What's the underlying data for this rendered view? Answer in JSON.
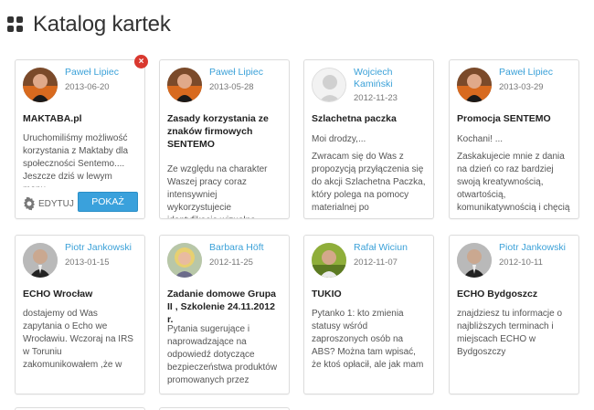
{
  "page": {
    "title": "Katalog kartek"
  },
  "actions": {
    "edit_label": "EDYTUJ",
    "show_label": "POKAŻ",
    "delete_glyph": "×"
  },
  "cards": [
    {
      "author": "Paweł Lipiec",
      "date": "2013-06-20",
      "title": "MAKTABA.pl",
      "text": "Uruchomiliśmy możliwość korzystania z Maktaby dla społeczności Sentemo.... Jeszcze dziś w lewym menu",
      "avatar": "pawel"
    },
    {
      "author": "Paweł Lipiec",
      "date": "2013-05-28",
      "title": "Zasady korzystania ze znaków firmowych SENTEMO",
      "text": "Ze względu na charakter Waszej pracy coraz intensywniej wykorzystujecie identyfikację wizualną marki. Tymczasem korzystanie",
      "avatar": "pawel"
    },
    {
      "author": "Wojciech Kamiński",
      "date": "2012-11-23",
      "title": "Szlachetna paczka",
      "text1": "Moi drodzy,...",
      "text": "Zwracam się do Was z propozycją przyłączenia się do akcji Szlachetna Paczka, który polega na pomocy materialnej po",
      "avatar": "default"
    },
    {
      "author": "Paweł Lipiec",
      "date": "2013-03-29",
      "title": "Promocja SENTEMO",
      "text1": "Kochani! ...",
      "text": "Zaskakujecie mnie z dania na dzień co raz bardziej swoją kreatywnością, otwartością, komunikatywnością i chęcią do",
      "avatar": "pawel"
    },
    {
      "author": "Piotr Jankowski",
      "date": "2013-01-15",
      "title": "ECHO Wrocław",
      "text": "dostajemy od Was zapytania o Echo we Wrocławiu. Wczoraj na IRS w Toruniu zakomunikowałem ,że w tym miejscu zbiorę od Was potenc...",
      "avatar": "piotr"
    },
    {
      "author": "Barbara Höft",
      "date": "2012-11-25",
      "title": "Zadanie domowe Grupa II , Szkolenie 24.11.2012 r.",
      "text": "Pytania sugerujące i naprowadzające na odpowiedź dotyczące bezpieczeństwa produktów promowanych przez SENTEMO",
      "avatar": "barbara"
    },
    {
      "author": "Rafał Wiciun",
      "date": "2012-11-07",
      "title": "TUKIO",
      "text": "Pytanko 1: kto zmienia statusy wśród zaproszonych osób na ABS? Można tam wpisać, że ktoś opłacił, ale jak mam zapłacić za siebi...",
      "avatar": "rafal"
    },
    {
      "author": "Piotr Jankowski",
      "date": "2012-10-11",
      "title": "ECHO Bydgoszcz",
      "text": "znajdziesz tu informacje o najbliższych terminach i miejscach ECHO w Bydgoszczy",
      "avatar": "piotr"
    }
  ]
}
